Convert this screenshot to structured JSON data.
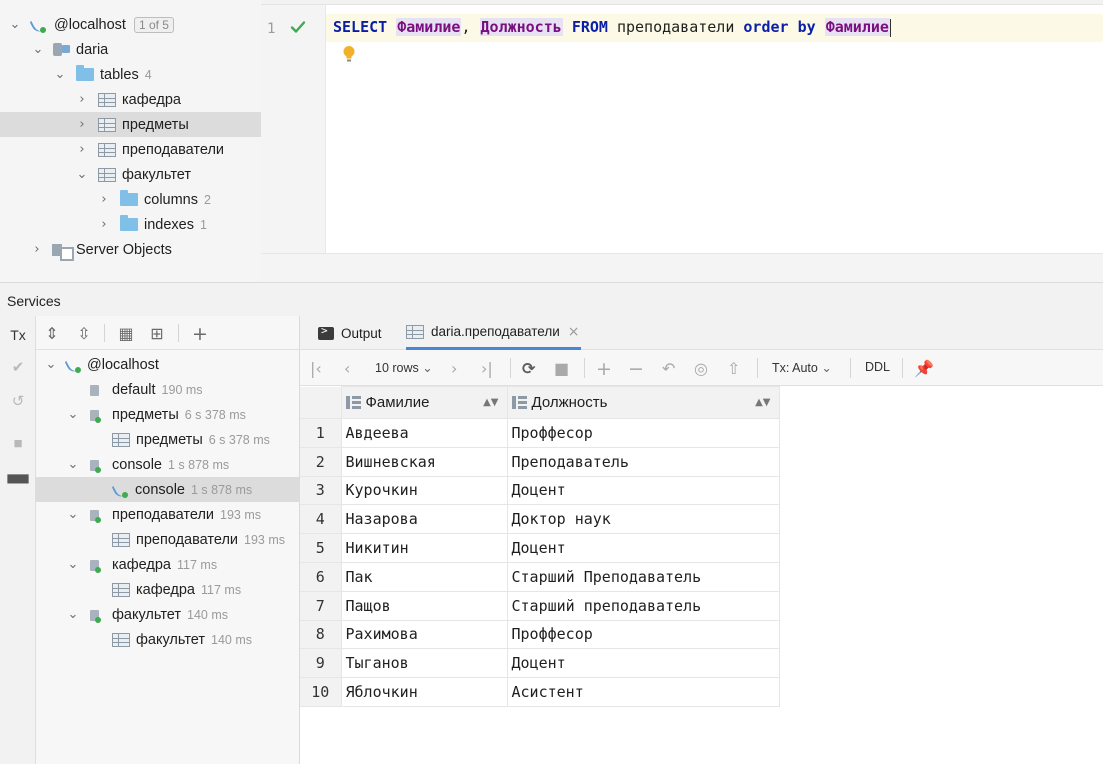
{
  "db_tree": {
    "host": {
      "label": "@localhost",
      "pager": "1 of 5"
    },
    "database": {
      "label": "daria"
    },
    "tables_folder": {
      "label": "tables",
      "count": "4"
    },
    "tables": [
      {
        "label": "кафедра"
      },
      {
        "label": "предметы"
      },
      {
        "label": "преподаватели"
      },
      {
        "label": "факультет"
      }
    ],
    "subfolders": [
      {
        "label": "columns",
        "count": "2"
      },
      {
        "label": "indexes",
        "count": "1"
      }
    ],
    "server_objects": {
      "label": "Server Objects"
    }
  },
  "editor": {
    "line_number": "1",
    "query": {
      "kw_select": "SELECT",
      "col1": "Фамилие",
      "comma": ",",
      "col2": "Должность",
      "kw_from": "FROM",
      "table": "преподаватели",
      "kw_order": "order by",
      "col3": "Фамилие"
    }
  },
  "services": {
    "title": "Services",
    "tx_label": "Tx",
    "tree": [
      {
        "label": "@localhost",
        "time": ""
      },
      {
        "label": "default",
        "time": "190 ms"
      },
      {
        "label": "предметы",
        "time": "6 s 378 ms"
      },
      {
        "label": "предметы",
        "time": "6 s 378 ms"
      },
      {
        "label": "console",
        "time": "1 s 878 ms"
      },
      {
        "label": "console",
        "time": "1 s 878 ms"
      },
      {
        "label": "преподаватели",
        "time": "193 ms"
      },
      {
        "label": "преподаватели",
        "time": "193 ms"
      },
      {
        "label": "кафедра",
        "time": "117 ms"
      },
      {
        "label": "кафедра",
        "time": "117 ms"
      },
      {
        "label": "факультет",
        "time": "140 ms"
      },
      {
        "label": "факультет",
        "time": "140 ms"
      }
    ]
  },
  "results": {
    "tabs": [
      {
        "label": "Output",
        "icon": "terminal-icon"
      },
      {
        "label": "daria.преподаватели",
        "icon": "table-icon"
      }
    ],
    "toolbar": {
      "rows_label": "10 rows",
      "tx_label": "Tx: Auto",
      "ddl_label": "DDL"
    },
    "columns": [
      "Фамилие",
      "Должность"
    ],
    "rows": [
      {
        "n": "1",
        "surname": "Авдеева",
        "position": "Проффесор"
      },
      {
        "n": "2",
        "surname": "Вишневская",
        "position": "Преподаватель"
      },
      {
        "n": "3",
        "surname": "Курочкин",
        "position": "Доцент"
      },
      {
        "n": "4",
        "surname": "Назарова",
        "position": "Доктор наук"
      },
      {
        "n": "5",
        "surname": "Никитин",
        "position": "Доцент"
      },
      {
        "n": "6",
        "surname": "Пак",
        "position": "Старший Преподаватель"
      },
      {
        "n": "7",
        "surname": "Пащов",
        "position": "Старший преподаватель"
      },
      {
        "n": "8",
        "surname": "Рахимова",
        "position": "Проффесор"
      },
      {
        "n": "9",
        "surname": "Тыганов",
        "position": "Доцент"
      },
      {
        "n": "10",
        "surname": "Яблочкин",
        "position": "Асистент"
      }
    ]
  },
  "colors": {
    "keyword": "#0b1fa6",
    "column_ref": "#7a0f7f",
    "success_check": "#3dab4f",
    "active_tab": "#4a86d6"
  }
}
